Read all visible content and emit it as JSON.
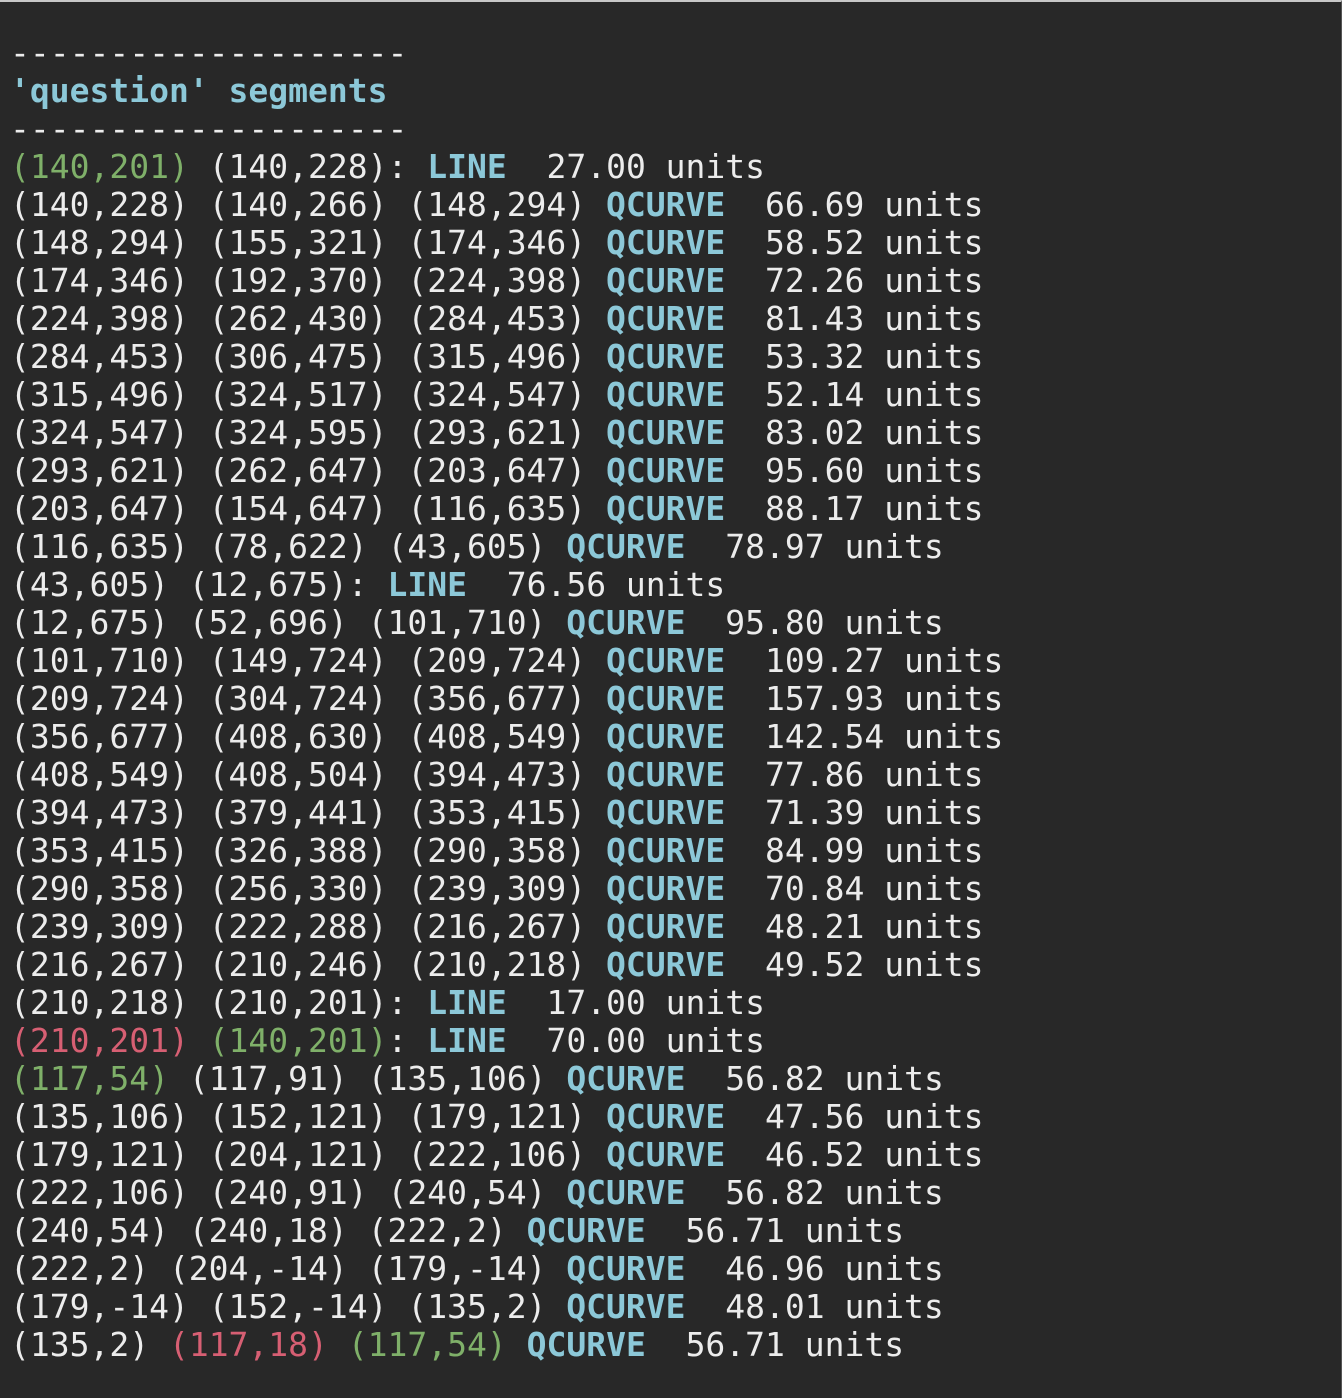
{
  "header": {
    "separator": "--------------------",
    "title": "'question' segments"
  },
  "colors": {
    "background": "#282828",
    "text": "#ececec",
    "keyword": "#8cc8d8",
    "start_point": "#7fb069",
    "end_point": "#d75f73"
  },
  "segments": [
    {
      "parts": [
        {
          "t": "(140,201)",
          "c": "green"
        },
        {
          "t": " "
        },
        {
          "t": "(140,228)"
        },
        {
          "t": ": "
        },
        {
          "t": "LINE",
          "c": "kw"
        },
        {
          "t": "  27.00 units"
        }
      ]
    },
    {
      "parts": [
        {
          "t": "(140,228) (140,266) (148,294) "
        },
        {
          "t": "QCURVE",
          "c": "kw"
        },
        {
          "t": "  66.69 units"
        }
      ]
    },
    {
      "parts": [
        {
          "t": "(148,294) (155,321) (174,346) "
        },
        {
          "t": "QCURVE",
          "c": "kw"
        },
        {
          "t": "  58.52 units"
        }
      ]
    },
    {
      "parts": [
        {
          "t": "(174,346) (192,370) (224,398) "
        },
        {
          "t": "QCURVE",
          "c": "kw"
        },
        {
          "t": "  72.26 units"
        }
      ]
    },
    {
      "parts": [
        {
          "t": "(224,398) (262,430) (284,453) "
        },
        {
          "t": "QCURVE",
          "c": "kw"
        },
        {
          "t": "  81.43 units"
        }
      ]
    },
    {
      "parts": [
        {
          "t": "(284,453) (306,475) (315,496) "
        },
        {
          "t": "QCURVE",
          "c": "kw"
        },
        {
          "t": "  53.32 units"
        }
      ]
    },
    {
      "parts": [
        {
          "t": "(315,496) (324,517) (324,547) "
        },
        {
          "t": "QCURVE",
          "c": "kw"
        },
        {
          "t": "  52.14 units"
        }
      ]
    },
    {
      "parts": [
        {
          "t": "(324,547) (324,595) (293,621) "
        },
        {
          "t": "QCURVE",
          "c": "kw"
        },
        {
          "t": "  83.02 units"
        }
      ]
    },
    {
      "parts": [
        {
          "t": "(293,621) (262,647) (203,647) "
        },
        {
          "t": "QCURVE",
          "c": "kw"
        },
        {
          "t": "  95.60 units"
        }
      ]
    },
    {
      "parts": [
        {
          "t": "(203,647) (154,647) (116,635) "
        },
        {
          "t": "QCURVE",
          "c": "kw"
        },
        {
          "t": "  88.17 units"
        }
      ]
    },
    {
      "parts": [
        {
          "t": "(116,635) (78,622) (43,605) "
        },
        {
          "t": "QCURVE",
          "c": "kw"
        },
        {
          "t": "  78.97 units"
        }
      ]
    },
    {
      "parts": [
        {
          "t": "(43,605) (12,675): "
        },
        {
          "t": "LINE",
          "c": "kw"
        },
        {
          "t": "  76.56 units"
        }
      ]
    },
    {
      "parts": [
        {
          "t": "(12,675) (52,696) (101,710) "
        },
        {
          "t": "QCURVE",
          "c": "kw"
        },
        {
          "t": "  95.80 units"
        }
      ]
    },
    {
      "parts": [
        {
          "t": "(101,710) (149,724) (209,724) "
        },
        {
          "t": "QCURVE",
          "c": "kw"
        },
        {
          "t": "  109.27 units"
        }
      ]
    },
    {
      "parts": [
        {
          "t": "(209,724) (304,724) (356,677) "
        },
        {
          "t": "QCURVE",
          "c": "kw"
        },
        {
          "t": "  157.93 units"
        }
      ]
    },
    {
      "parts": [
        {
          "t": "(356,677) (408,630) (408,549) "
        },
        {
          "t": "QCURVE",
          "c": "kw"
        },
        {
          "t": "  142.54 units"
        }
      ]
    },
    {
      "parts": [
        {
          "t": "(408,549) (408,504) (394,473) "
        },
        {
          "t": "QCURVE",
          "c": "kw"
        },
        {
          "t": "  77.86 units"
        }
      ]
    },
    {
      "parts": [
        {
          "t": "(394,473) (379,441) (353,415) "
        },
        {
          "t": "QCURVE",
          "c": "kw"
        },
        {
          "t": "  71.39 units"
        }
      ]
    },
    {
      "parts": [
        {
          "t": "(353,415) (326,388) (290,358) "
        },
        {
          "t": "QCURVE",
          "c": "kw"
        },
        {
          "t": "  84.99 units"
        }
      ]
    },
    {
      "parts": [
        {
          "t": "(290,358) (256,330) (239,309) "
        },
        {
          "t": "QCURVE",
          "c": "kw"
        },
        {
          "t": "  70.84 units"
        }
      ]
    },
    {
      "parts": [
        {
          "t": "(239,309) (222,288) (216,267) "
        },
        {
          "t": "QCURVE",
          "c": "kw"
        },
        {
          "t": "  48.21 units"
        }
      ]
    },
    {
      "parts": [
        {
          "t": "(216,267) (210,246) (210,218) "
        },
        {
          "t": "QCURVE",
          "c": "kw"
        },
        {
          "t": "  49.52 units"
        }
      ]
    },
    {
      "parts": [
        {
          "t": "(210,218) (210,201): "
        },
        {
          "t": "LINE",
          "c": "kw"
        },
        {
          "t": "  17.00 units"
        }
      ]
    },
    {
      "parts": [
        {
          "t": "(210,201)",
          "c": "red"
        },
        {
          "t": " "
        },
        {
          "t": "(140,201)",
          "c": "green"
        },
        {
          "t": ": "
        },
        {
          "t": "LINE",
          "c": "kw"
        },
        {
          "t": "  70.00 units"
        }
      ]
    },
    {
      "parts": [
        {
          "t": "(117,54)",
          "c": "green"
        },
        {
          "t": " (117,91) (135,106) "
        },
        {
          "t": "QCURVE",
          "c": "kw"
        },
        {
          "t": "  56.82 units"
        }
      ]
    },
    {
      "parts": [
        {
          "t": "(135,106) (152,121) (179,121) "
        },
        {
          "t": "QCURVE",
          "c": "kw"
        },
        {
          "t": "  47.56 units"
        }
      ]
    },
    {
      "parts": [
        {
          "t": "(179,121) (204,121) (222,106) "
        },
        {
          "t": "QCURVE",
          "c": "kw"
        },
        {
          "t": "  46.52 units"
        }
      ]
    },
    {
      "parts": [
        {
          "t": "(222,106) (240,91) (240,54) "
        },
        {
          "t": "QCURVE",
          "c": "kw"
        },
        {
          "t": "  56.82 units"
        }
      ]
    },
    {
      "parts": [
        {
          "t": "(240,54) (240,18) (222,2) "
        },
        {
          "t": "QCURVE",
          "c": "kw"
        },
        {
          "t": "  56.71 units"
        }
      ]
    },
    {
      "parts": [
        {
          "t": "(222,2) (204,-14) (179,-14) "
        },
        {
          "t": "QCURVE",
          "c": "kw"
        },
        {
          "t": "  46.96 units"
        }
      ]
    },
    {
      "parts": [
        {
          "t": "(179,-14) (152,-14) (135,2) "
        },
        {
          "t": "QCURVE",
          "c": "kw"
        },
        {
          "t": "  48.01 units"
        }
      ]
    },
    {
      "parts": [
        {
          "t": "(135,2) "
        },
        {
          "t": "(117,18)",
          "c": "red"
        },
        {
          "t": " "
        },
        {
          "t": "(117,54)",
          "c": "green"
        },
        {
          "t": " "
        },
        {
          "t": "QCURVE",
          "c": "kw"
        },
        {
          "t": "  56.71 units"
        }
      ]
    }
  ]
}
